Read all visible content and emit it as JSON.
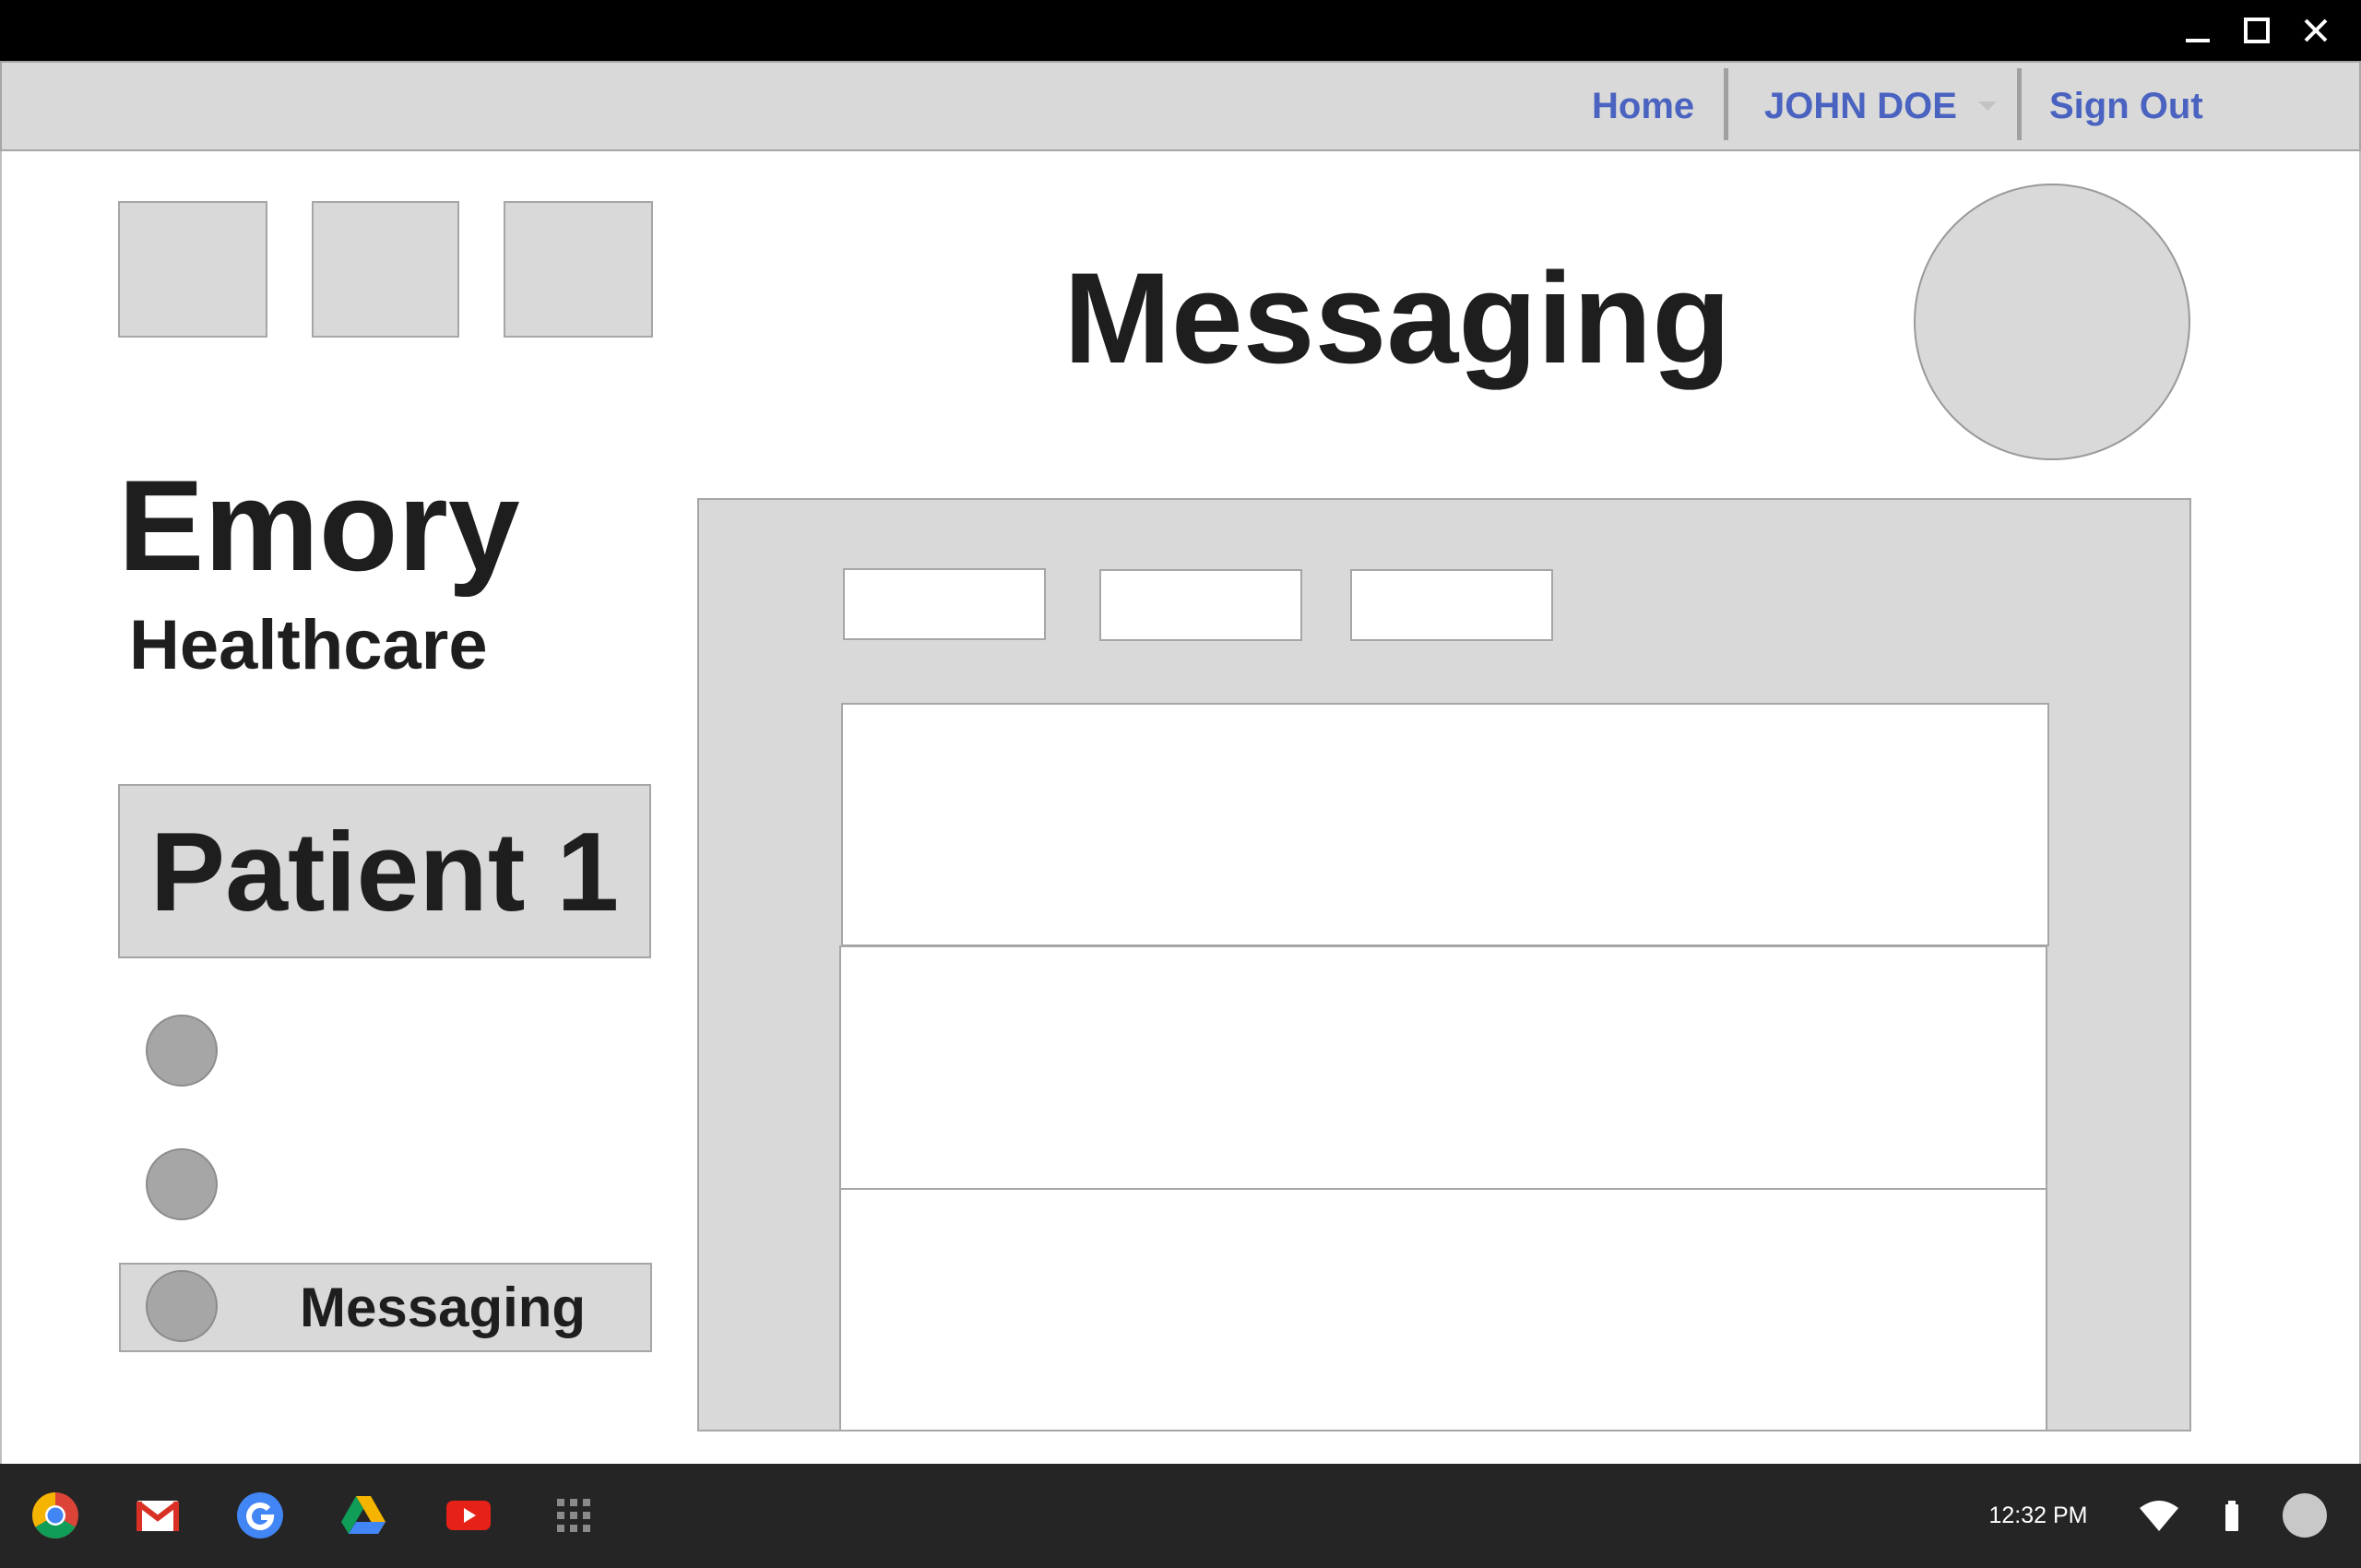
{
  "window": {
    "controls": [
      "minimize-icon",
      "maximize-icon",
      "close-icon"
    ]
  },
  "nav": {
    "home": "Home",
    "user": "JOHN DOE",
    "signout": "Sign Out",
    "link_color": "#4a63c0"
  },
  "page": {
    "title": "Messaging"
  },
  "brand": {
    "name": "Emory",
    "sub": "Healthcare"
  },
  "sidebar": {
    "patient": "Patient 1",
    "menu_messaging": "Messaging"
  },
  "taskbar": {
    "apps": [
      "chrome-icon",
      "gmail-icon",
      "google-icon",
      "drive-icon",
      "youtube-icon",
      "app-launcher-icon"
    ],
    "time": "12:32 PM",
    "status_icons": [
      "wifi-icon",
      "battery-icon",
      "account-avatar"
    ]
  }
}
